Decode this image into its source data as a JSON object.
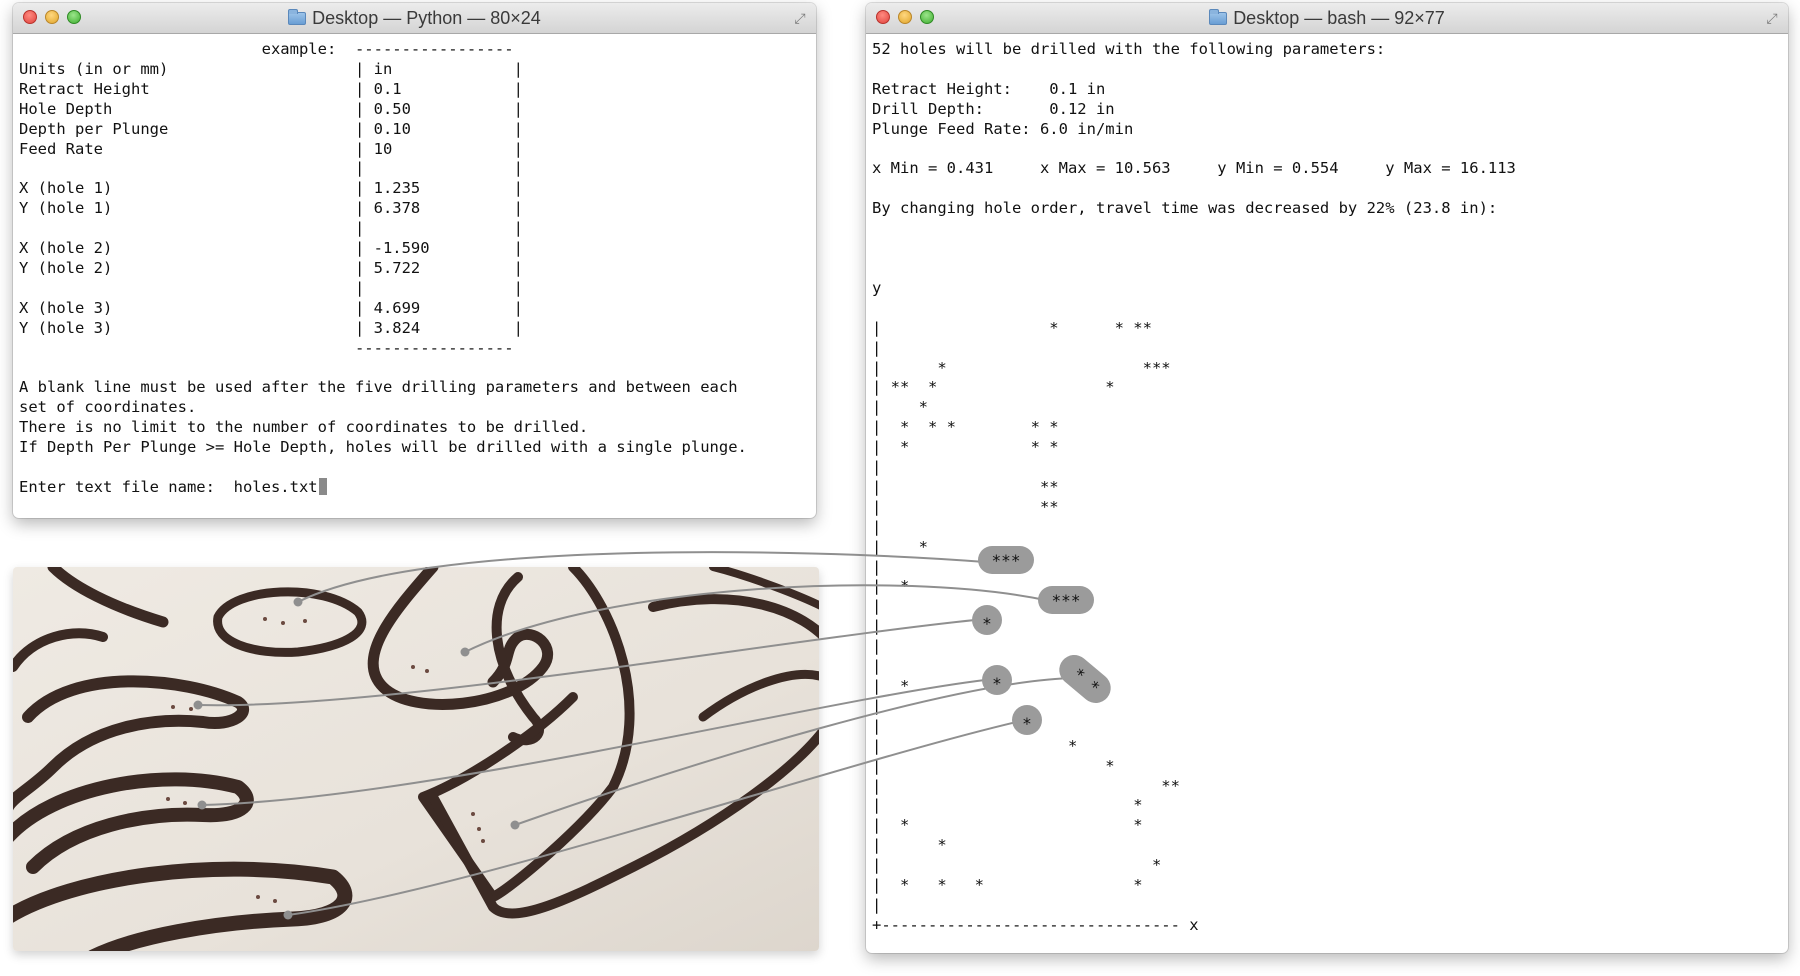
{
  "python_window": {
    "title": "Desktop — Python — 80×24",
    "lines": [
      "                          example:  -----------------",
      "Units (in or mm)                    | in             |",
      "Retract Height                      | 0.1            |",
      "Hole Depth                          | 0.50           |",
      "Depth per Plunge                    | 0.10           |",
      "Feed Rate                           | 10             |",
      "                                    |                |",
      "X (hole 1)                          | 1.235          |",
      "Y (hole 1)                          | 6.378          |",
      "                                    |                |",
      "X (hole 2)                          | -1.590         |",
      "Y (hole 2)                          | 5.722          |",
      "                                    |                |",
      "X (hole 3)                          | 4.699          |",
      "Y (hole 3)                          | 3.824          |",
      "                                    -----------------",
      "",
      "A blank line must be used after the five drilling parameters and between each",
      "set of coordinates.",
      "There is no limit to the number of coordinates to be drilled.",
      "If Depth Per Plunge >= Hole Depth, holes will be drilled with a single plunge.",
      ""
    ],
    "prompt": "Enter text file name:  holes.txt"
  },
  "bash_window": {
    "title": "Desktop — bash — 92×77",
    "lines": [
      "52 holes will be drilled with the following parameters:",
      "",
      "Retract Height:    0.1 in",
      "Drill Depth:       0.12 in",
      "Plunge Feed Rate: 6.0 in/min",
      "",
      "x Min = 0.431     x Max = 10.563     y Min = 0.554     y Max = 16.113",
      "",
      "By changing hole order, travel time was decreased by 22% (23.8 in):",
      "",
      "",
      "",
      "y",
      "",
      "|                  *      * **",
      "|",
      "|      *                     ***",
      "| **  *                  *",
      "|    *",
      "|  *  * *        * *",
      "|  *             * *",
      "|",
      "|                 **",
      "|                 **",
      "|",
      "|    *",
      "|",
      "|  *",
      "|",
      "|",
      "|",
      "|",
      "|  *",
      "|",
      "|",
      "|                    *",
      "|                        *",
      "|                              **",
      "|                           *",
      "|  *                        *",
      "|      *",
      "|                             *",
      "|  *   *   *                *",
      "|",
      "+-------------------------------- x"
    ]
  },
  "callouts": [
    {
      "label": "***"
    },
    {
      "label": "***"
    },
    {
      "label": "*"
    },
    {
      "label": "*"
    },
    {
      "label": "*"
    },
    {
      "label": "* *"
    }
  ],
  "colors": {
    "callout_fill": "#9b9b9b",
    "callout_line": "#8f8f8f",
    "photo_background": "#ebe6df",
    "groove": "#3b2a24"
  }
}
